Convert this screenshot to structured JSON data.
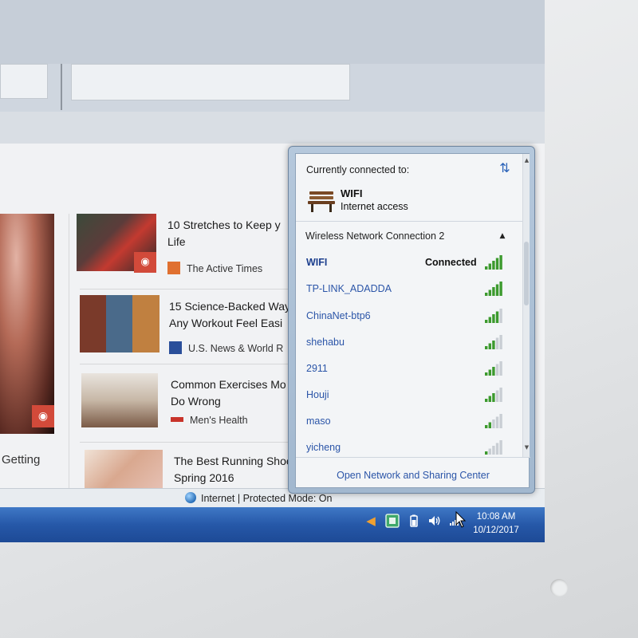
{
  "content": {
    "hero_caption": "Getting",
    "articles": [
      {
        "title_line1": "10 Stretches to Keep y",
        "title_line2": "Life",
        "source": "The Active Times"
      },
      {
        "title_line1": "15 Science-Backed Way",
        "title_line2": "Any Workout Feel Easi",
        "source": "U.S. News & World R"
      },
      {
        "title_line1": "Common Exercises Mo",
        "title_line2": "Do Wrong",
        "source": "Men's Health"
      },
      {
        "title_line1": "The Best Running Shoe",
        "title_line2": "Spring 2016",
        "source": ""
      }
    ]
  },
  "network_flyout": {
    "header": "Currently connected to:",
    "current": {
      "name": "WIFI",
      "status": "Internet access"
    },
    "group_label": "Wireless Network Connection 2",
    "networks": [
      {
        "ssid": "WIFI",
        "state": "Connected",
        "bars": 5,
        "bold": true
      },
      {
        "ssid": "TP-LINK_ADADDA",
        "state": "",
        "bars": 5,
        "bold": false
      },
      {
        "ssid": "ChinaNet-btp6",
        "state": "",
        "bars": 4,
        "bold": false
      },
      {
        "ssid": "shehabu",
        "state": "",
        "bars": 3,
        "bold": false
      },
      {
        "ssid": "2911",
        "state": "",
        "bars": 3,
        "bold": false
      },
      {
        "ssid": "Houji",
        "state": "",
        "bars": 3,
        "bold": false
      },
      {
        "ssid": "maso",
        "state": "",
        "bars": 2,
        "bold": false
      },
      {
        "ssid": "yicheng",
        "state": "",
        "bars": 1,
        "bold": false
      }
    ],
    "footer_link": "Open Network and Sharing Center"
  },
  "statusbar": {
    "text": "Internet | Protected Mode: On"
  },
  "taskbar": {
    "time": "10:08 AM",
    "date": "10/12/2017"
  },
  "colors": {
    "taskbar": "#2658a8",
    "link": "#2b55a8",
    "signal": "#3c9a2e"
  }
}
